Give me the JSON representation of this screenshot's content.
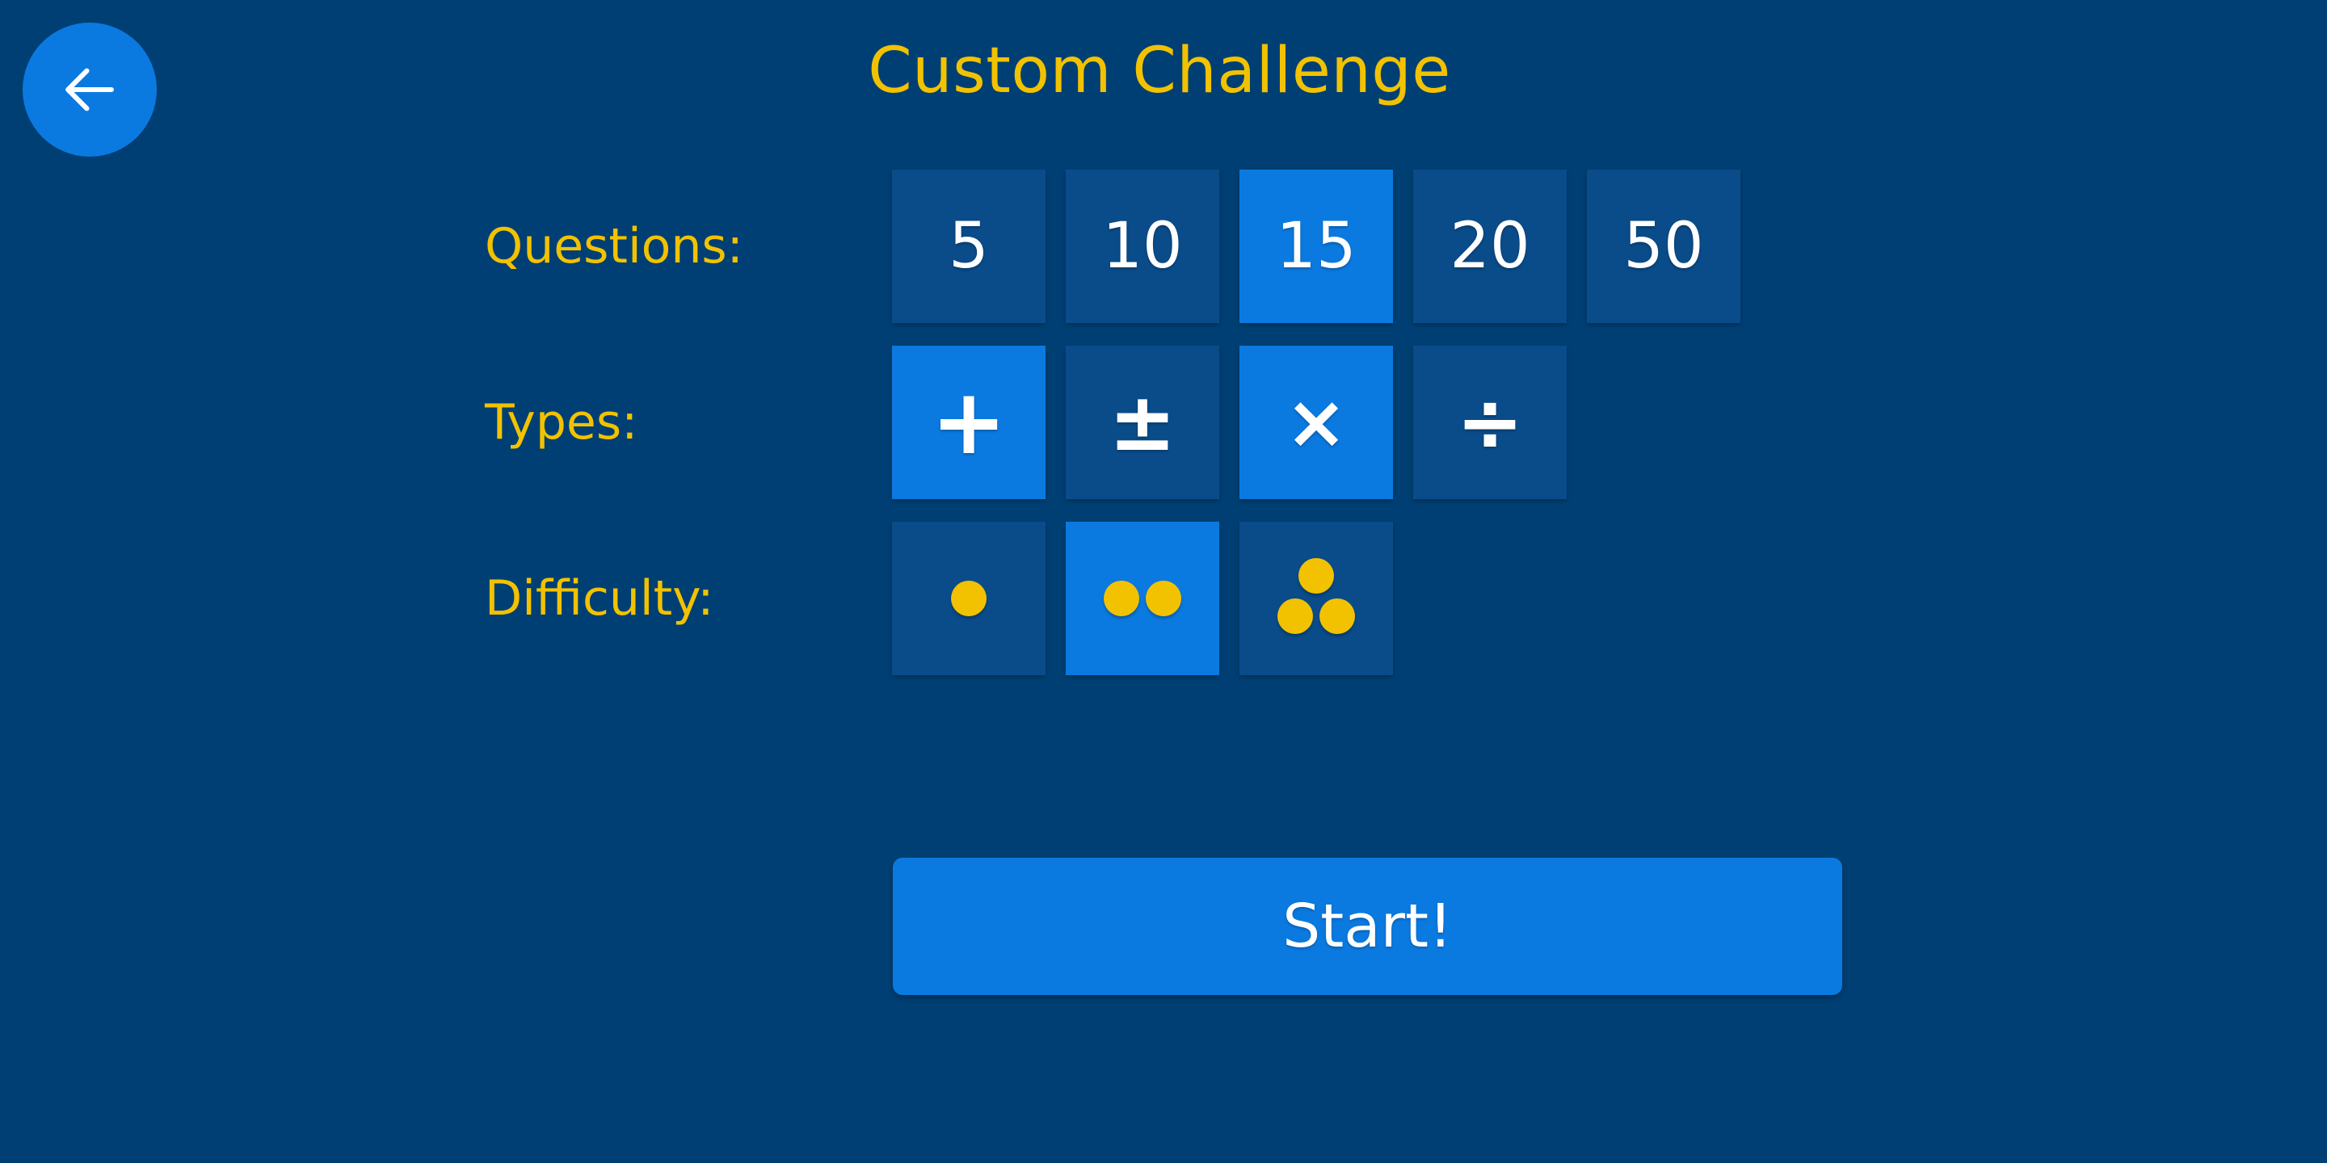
{
  "theme": {
    "background": "#003f73",
    "tile_unselected": "#0a4c8a",
    "tile_selected": "#0b7ae0",
    "accent_yellow": "#f2c200",
    "text_white": "#ffffff"
  },
  "header": {
    "title": "Custom Challenge",
    "back_icon": "arrow-left-icon"
  },
  "rows": {
    "questions": {
      "label": "Questions:",
      "options": [
        {
          "value": "5",
          "selected": false
        },
        {
          "value": "10",
          "selected": false
        },
        {
          "value": "15",
          "selected": true
        },
        {
          "value": "20",
          "selected": false
        },
        {
          "value": "50",
          "selected": false
        }
      ]
    },
    "types": {
      "label": "Types:",
      "options": [
        {
          "value": "+",
          "icon": "plus-icon",
          "selected": true
        },
        {
          "value": "±",
          "icon": "plus-minus-icon",
          "selected": false
        },
        {
          "value": "×",
          "icon": "multiply-icon",
          "selected": true
        },
        {
          "value": "÷",
          "icon": "divide-icon",
          "selected": false
        }
      ]
    },
    "difficulty": {
      "label": "Difficulty:",
      "options": [
        {
          "dots": 1,
          "icon": "one-dot-icon",
          "selected": false
        },
        {
          "dots": 2,
          "icon": "two-dots-icon",
          "selected": true
        },
        {
          "dots": 3,
          "icon": "three-dots-icon",
          "selected": false
        }
      ]
    }
  },
  "start": {
    "label": "Start!"
  }
}
